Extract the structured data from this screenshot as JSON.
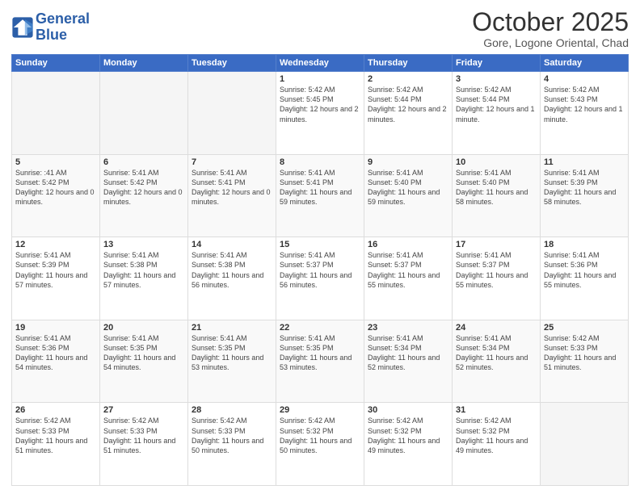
{
  "header": {
    "logo_line1": "General",
    "logo_line2": "Blue",
    "month": "October 2025",
    "location": "Gore, Logone Oriental, Chad"
  },
  "weekdays": [
    "Sunday",
    "Monday",
    "Tuesday",
    "Wednesday",
    "Thursday",
    "Friday",
    "Saturday"
  ],
  "weeks": [
    [
      {
        "day": "",
        "info": ""
      },
      {
        "day": "",
        "info": ""
      },
      {
        "day": "",
        "info": ""
      },
      {
        "day": "1",
        "info": "Sunrise: 5:42 AM\nSunset: 5:45 PM\nDaylight: 12 hours and 2 minutes."
      },
      {
        "day": "2",
        "info": "Sunrise: 5:42 AM\nSunset: 5:44 PM\nDaylight: 12 hours and 2 minutes."
      },
      {
        "day": "3",
        "info": "Sunrise: 5:42 AM\nSunset: 5:44 PM\nDaylight: 12 hours and 1 minute."
      },
      {
        "day": "4",
        "info": "Sunrise: 5:42 AM\nSunset: 5:43 PM\nDaylight: 12 hours and 1 minute."
      }
    ],
    [
      {
        "day": "5",
        "info": "Sunrise: :41 AM\nSunset: 5:42 PM\nDaylight: 12 hours and 0 minutes."
      },
      {
        "day": "6",
        "info": "Sunrise: 5:41 AM\nSunset: 5:42 PM\nDaylight: 12 hours and 0 minutes."
      },
      {
        "day": "7",
        "info": "Sunrise: 5:41 AM\nSunset: 5:41 PM\nDaylight: 12 hours and 0 minutes."
      },
      {
        "day": "8",
        "info": "Sunrise: 5:41 AM\nSunset: 5:41 PM\nDaylight: 11 hours and 59 minutes."
      },
      {
        "day": "9",
        "info": "Sunrise: 5:41 AM\nSunset: 5:40 PM\nDaylight: 11 hours and 59 minutes."
      },
      {
        "day": "10",
        "info": "Sunrise: 5:41 AM\nSunset: 5:40 PM\nDaylight: 11 hours and 58 minutes."
      },
      {
        "day": "11",
        "info": "Sunrise: 5:41 AM\nSunset: 5:39 PM\nDaylight: 11 hours and 58 minutes."
      }
    ],
    [
      {
        "day": "12",
        "info": "Sunrise: 5:41 AM\nSunset: 5:39 PM\nDaylight: 11 hours and 57 minutes."
      },
      {
        "day": "13",
        "info": "Sunrise: 5:41 AM\nSunset: 5:38 PM\nDaylight: 11 hours and 57 minutes."
      },
      {
        "day": "14",
        "info": "Sunrise: 5:41 AM\nSunset: 5:38 PM\nDaylight: 11 hours and 56 minutes."
      },
      {
        "day": "15",
        "info": "Sunrise: 5:41 AM\nSunset: 5:37 PM\nDaylight: 11 hours and 56 minutes."
      },
      {
        "day": "16",
        "info": "Sunrise: 5:41 AM\nSunset: 5:37 PM\nDaylight: 11 hours and 55 minutes."
      },
      {
        "day": "17",
        "info": "Sunrise: 5:41 AM\nSunset: 5:37 PM\nDaylight: 11 hours and 55 minutes."
      },
      {
        "day": "18",
        "info": "Sunrise: 5:41 AM\nSunset: 5:36 PM\nDaylight: 11 hours and 55 minutes."
      }
    ],
    [
      {
        "day": "19",
        "info": "Sunrise: 5:41 AM\nSunset: 5:36 PM\nDaylight: 11 hours and 54 minutes."
      },
      {
        "day": "20",
        "info": "Sunrise: 5:41 AM\nSunset: 5:35 PM\nDaylight: 11 hours and 54 minutes."
      },
      {
        "day": "21",
        "info": "Sunrise: 5:41 AM\nSunset: 5:35 PM\nDaylight: 11 hours and 53 minutes."
      },
      {
        "day": "22",
        "info": "Sunrise: 5:41 AM\nSunset: 5:35 PM\nDaylight: 11 hours and 53 minutes."
      },
      {
        "day": "23",
        "info": "Sunrise: 5:41 AM\nSunset: 5:34 PM\nDaylight: 11 hours and 52 minutes."
      },
      {
        "day": "24",
        "info": "Sunrise: 5:41 AM\nSunset: 5:34 PM\nDaylight: 11 hours and 52 minutes."
      },
      {
        "day": "25",
        "info": "Sunrise: 5:42 AM\nSunset: 5:33 PM\nDaylight: 11 hours and 51 minutes."
      }
    ],
    [
      {
        "day": "26",
        "info": "Sunrise: 5:42 AM\nSunset: 5:33 PM\nDaylight: 11 hours and 51 minutes."
      },
      {
        "day": "27",
        "info": "Sunrise: 5:42 AM\nSunset: 5:33 PM\nDaylight: 11 hours and 51 minutes."
      },
      {
        "day": "28",
        "info": "Sunrise: 5:42 AM\nSunset: 5:33 PM\nDaylight: 11 hours and 50 minutes."
      },
      {
        "day": "29",
        "info": "Sunrise: 5:42 AM\nSunset: 5:32 PM\nDaylight: 11 hours and 50 minutes."
      },
      {
        "day": "30",
        "info": "Sunrise: 5:42 AM\nSunset: 5:32 PM\nDaylight: 11 hours and 49 minutes."
      },
      {
        "day": "31",
        "info": "Sunrise: 5:42 AM\nSunset: 5:32 PM\nDaylight: 11 hours and 49 minutes."
      },
      {
        "day": "",
        "info": ""
      }
    ]
  ]
}
